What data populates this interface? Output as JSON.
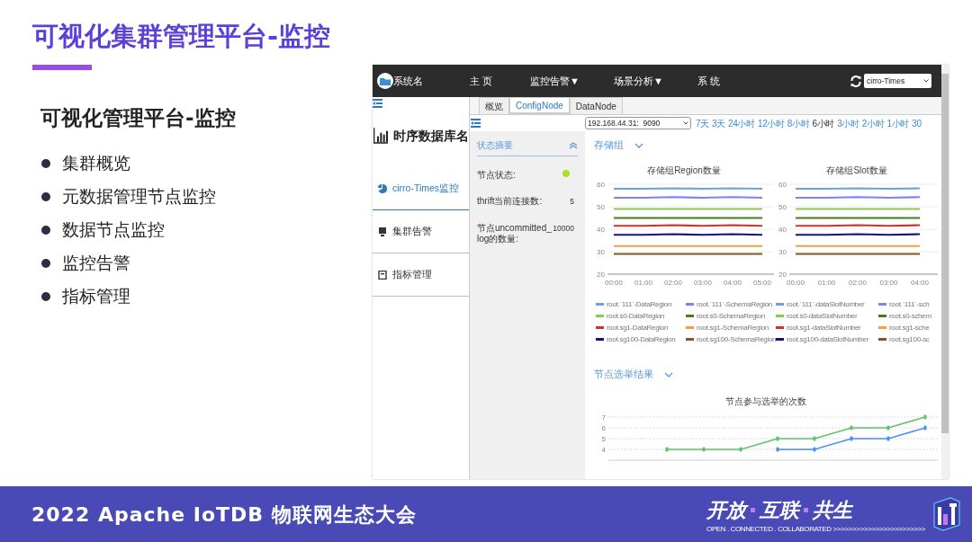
{
  "slide": {
    "title": "可视化集群管理平台-监控",
    "heading": "可视化管理平台-监控",
    "bullets": [
      "集群概览",
      "元数据管理节点监控",
      "数据节点监控",
      "监控告警",
      "指标管理"
    ]
  },
  "app": {
    "topbar": {
      "brand": "系统名",
      "nav": [
        "主 页",
        "监控告警▼",
        "场景分析▼",
        "系 统"
      ],
      "db_select": "cirro-Times"
    },
    "sidebar": {
      "title": "时序数据库名",
      "items": [
        {
          "label": "cirro-Times监控",
          "kind": "pie",
          "selected": true
        },
        {
          "label": "集群告警",
          "kind": "monitor",
          "selected": false
        },
        {
          "label": "指标管理",
          "kind": "doc",
          "selected": false
        }
      ]
    },
    "tabs": [
      {
        "label": "概览",
        "selected": false
      },
      {
        "label": "ConfigNode",
        "selected": true
      },
      {
        "label": "DataNode",
        "selected": false
      }
    ],
    "node_select": "192.168.44.31:  9090",
    "time_ranges": [
      {
        "label": "7天",
        "selected": false
      },
      {
        "label": "3天",
        "selected": false
      },
      {
        "label": "24小时",
        "selected": false
      },
      {
        "label": "12小时",
        "selected": false
      },
      {
        "label": "8小时",
        "selected": false
      },
      {
        "label": "6小时",
        "selected": true
      },
      {
        "label": "3小时",
        "selected": false
      },
      {
        "label": "2小时",
        "selected": false
      },
      {
        "label": "1小时",
        "selected": false
      },
      {
        "label": "30",
        "selected": false
      }
    ],
    "status": {
      "title": "状态摘要",
      "expanded": true,
      "rows": [
        {
          "kind": "dot",
          "label": "节点状态:",
          "online": true
        },
        {
          "kind": "value",
          "label": "thrift当前连接数:",
          "value": "5"
        },
        {
          "kind": "value",
          "label": "节点uncommitted_log的数量:",
          "value": "10000"
        }
      ]
    },
    "sections": [
      {
        "title": "存储组",
        "expanded": false,
        "charts": [
          {
            "kind": "legend",
            "chart_data": {
              "type": "line",
              "title": "存储组Region数量",
              "grid": true,
              "categories": [
                "00:00",
                "01:00",
                "02:00",
                "03:00",
                "04:00",
                "05:00"
              ],
              "ylim": [
                20,
                60
              ],
              "yticks": [
                20,
                30,
                40,
                50,
                60
              ],
              "series": [
                {
                  "name": "root.`111`-DataRegion",
                  "color": "#6aa2e8",
                  "values": [
                    58,
                    58,
                    58.2,
                    58,
                    58.2,
                    58
                  ]
                },
                {
                  "name": "root.`111`-SchemaRegion",
                  "color": "#8080ff",
                  "values": [
                    54,
                    54,
                    54.3,
                    54,
                    54.3,
                    54
                  ]
                },
                {
                  "name": "root.s0-DataRegion",
                  "color": "#8cc84b",
                  "values": [
                    49,
                    49,
                    49,
                    49,
                    49,
                    49
                  ]
                },
                {
                  "name": "root.s0-SchemaRegion",
                  "color": "#4b7a1e",
                  "values": [
                    45,
                    45,
                    45,
                    45,
                    45,
                    45
                  ]
                },
                {
                  "name": "root.sg1-DataRegion",
                  "color": "#d0302f",
                  "values": [
                    41.5,
                    41.5,
                    41.8,
                    41.5,
                    41.8,
                    41.5
                  ]
                },
                {
                  "name": "root.sg1-SchemaRegion",
                  "color": "#f2a040",
                  "values": [
                    32.5,
                    32.5,
                    32.5,
                    32.5,
                    32.5,
                    32.5
                  ]
                },
                {
                  "name": "root.sg100-DataRegion",
                  "color": "#14147a",
                  "values": [
                    37.5,
                    37.5,
                    37.8,
                    37.5,
                    37.8,
                    37.5
                  ]
                },
                {
                  "name": "root.sg100-SchemaRegion",
                  "color": "#7a5a20",
                  "values": [
                    29,
                    29,
                    29,
                    29,
                    29,
                    29
                  ]
                }
              ]
            }
          },
          {
            "kind": "legend",
            "chart_data": {
              "type": "line",
              "title": "存储组Slot数量",
              "grid": true,
              "categories": [
                "00:00",
                "01:00",
                "02:00",
                "03:00",
                "04:00"
              ],
              "ylim": [
                20,
                60
              ],
              "yticks": [
                20,
                30,
                40,
                50,
                60
              ],
              "series": [
                {
                  "name": "root.`111`-dataSlotNumber",
                  "color": "#6aa2e8",
                  "values": [
                    58,
                    58,
                    58.2,
                    58,
                    58.2
                  ]
                },
                {
                  "name": "root.`111`-sch",
                  "color": "#8080ff",
                  "values": [
                    54,
                    54,
                    54.3,
                    54,
                    54.3
                  ]
                },
                {
                  "name": "root.s0-dataSlotNumber",
                  "color": "#8cc84b",
                  "values": [
                    49,
                    49,
                    49,
                    49,
                    49
                  ]
                },
                {
                  "name": "root.s0-schem",
                  "color": "#4b7a1e",
                  "values": [
                    45,
                    45,
                    45,
                    45,
                    45
                  ]
                },
                {
                  "name": "root.sg1-dataSlotNumber",
                  "color": "#d0302f",
                  "values": [
                    41.5,
                    41.5,
                    41.8,
                    41.5,
                    41.8
                  ]
                },
                {
                  "name": "root.sg1-sche",
                  "color": "#f2a040",
                  "values": [
                    32.5,
                    32.5,
                    32.5,
                    32.5,
                    32.5
                  ]
                },
                {
                  "name": "root.sg100-dataSlotNumber",
                  "color": "#14147a",
                  "values": [
                    37.5,
                    37.5,
                    37.8,
                    37.5,
                    37.8
                  ]
                },
                {
                  "name": "root.sg100-sc",
                  "color": "#7a5a20",
                  "values": [
                    29,
                    29,
                    29,
                    29,
                    29
                  ]
                }
              ]
            }
          }
        ]
      },
      {
        "title": "节点选举结果",
        "expanded": false,
        "charts": [
          {
            "kind": "markers",
            "chart_data": {
              "type": "line",
              "title": "节点参与选举的次数",
              "grid": true,
              "ylim": [
                3,
                7
              ],
              "yticks": [
                4,
                5,
                6,
                7
              ],
              "series": [
                {
                  "color": "#5ec26a",
                  "values": [
                    null,
                    4,
                    4,
                    4,
                    5,
                    5,
                    6,
                    6,
                    7
                  ]
                },
                {
                  "color": "#4a90f0",
                  "values": [
                    null,
                    null,
                    null,
                    null,
                    4,
                    4,
                    5,
                    5,
                    6
                  ]
                }
              ]
            }
          }
        ]
      }
    ]
  },
  "footer": {
    "event": "2022 Apache IoTDB 物联网生态大会",
    "slogan": [
      "开放",
      "互联",
      "共生"
    ],
    "tagline": "OPEN . CONNECTED . COLLABORATED >>>>>>>>>>>>>>>>>>>>>>>>"
  }
}
